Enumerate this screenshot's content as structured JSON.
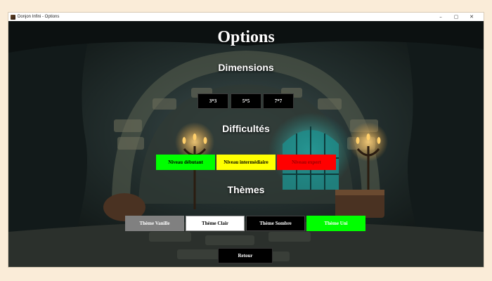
{
  "window": {
    "title": "Donjon Infini - Options",
    "controls": {
      "minimize": "–",
      "maximize": "▢",
      "close": "✕"
    }
  },
  "page": {
    "title": "Options",
    "dimensions": {
      "heading": "Dimensions",
      "buttons": [
        "3*3",
        "5*5",
        "7*7"
      ]
    },
    "difficulties": {
      "heading": "Difficultés",
      "buttons": [
        "Niveau débutant",
        "Niveau intermédiaire",
        "Niveau expert"
      ]
    },
    "themes": {
      "heading": "Thèmes",
      "buttons": [
        "Thème Vanille",
        "Thème Clair",
        "Thème Sombre",
        "Thème Uni"
      ]
    },
    "back_label": "Retour"
  },
  "colors": {
    "beginner": "#00ff00",
    "intermediate": "#ffff00",
    "expert": "#ff0000",
    "vanilla": "#808080",
    "light": "#ffffff",
    "dark": "#000000",
    "uni": "#00ff00"
  }
}
